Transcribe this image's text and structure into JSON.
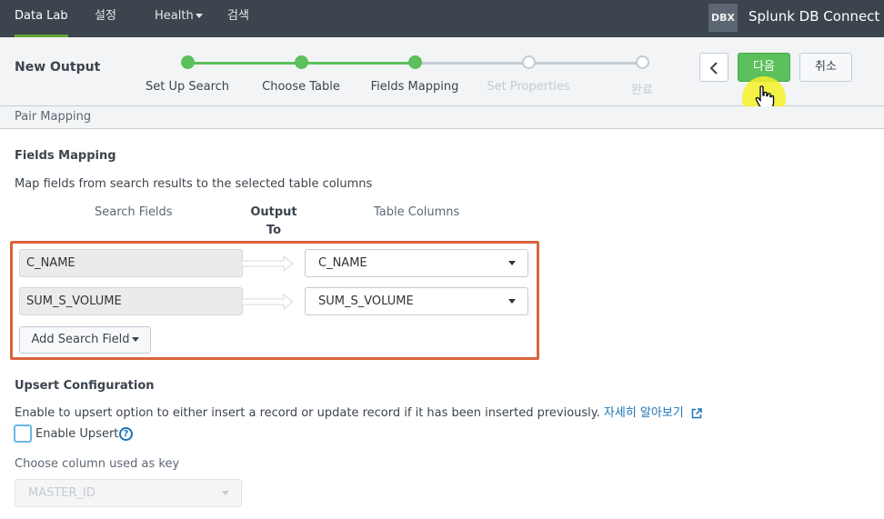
{
  "nav": {
    "items": [
      {
        "label": "Data Lab"
      },
      {
        "label": "설정"
      },
      {
        "label": "Health"
      },
      {
        "label": "검색"
      }
    ],
    "app_badge": "DBX",
    "app_name": "Splunk DB Connect"
  },
  "wizard": {
    "title": "New Output",
    "steps": [
      {
        "label": "Set Up Search",
        "status": "done"
      },
      {
        "label": "Choose Table",
        "status": "done"
      },
      {
        "label": "Fields Mapping",
        "status": "done"
      },
      {
        "label": "Set Properties",
        "status": "todo"
      },
      {
        "label": "완료",
        "status": "todo"
      }
    ],
    "next_label": "다음",
    "cancel_label": "취소"
  },
  "subheader": "Pair Mapping",
  "fields_mapping": {
    "title": "Fields Mapping",
    "description": "Map fields from search results to the selected table columns",
    "col_search": "Search Fields",
    "col_output": "Output To",
    "col_table": "Table Columns",
    "rows": [
      {
        "search_field": "C_NAME",
        "table_column": "C_NAME"
      },
      {
        "search_field": "SUM_S_VOLUME",
        "table_column": "SUM_S_VOLUME"
      }
    ],
    "add_label": "Add Search Field"
  },
  "upsert": {
    "title": "Upsert Configuration",
    "description": "Enable to upsert option to either insert a record or update record if it has been inserted previously.",
    "learn_more": "자세히 알아보기",
    "enable_label": "Enable Upsert",
    "help": "?",
    "key_label": "Choose column used as key",
    "key_value": "MASTER_ID"
  },
  "colors": {
    "accent_green": "#5cc05c",
    "highlight_border": "#d9643a",
    "link": "#1a73b5"
  }
}
